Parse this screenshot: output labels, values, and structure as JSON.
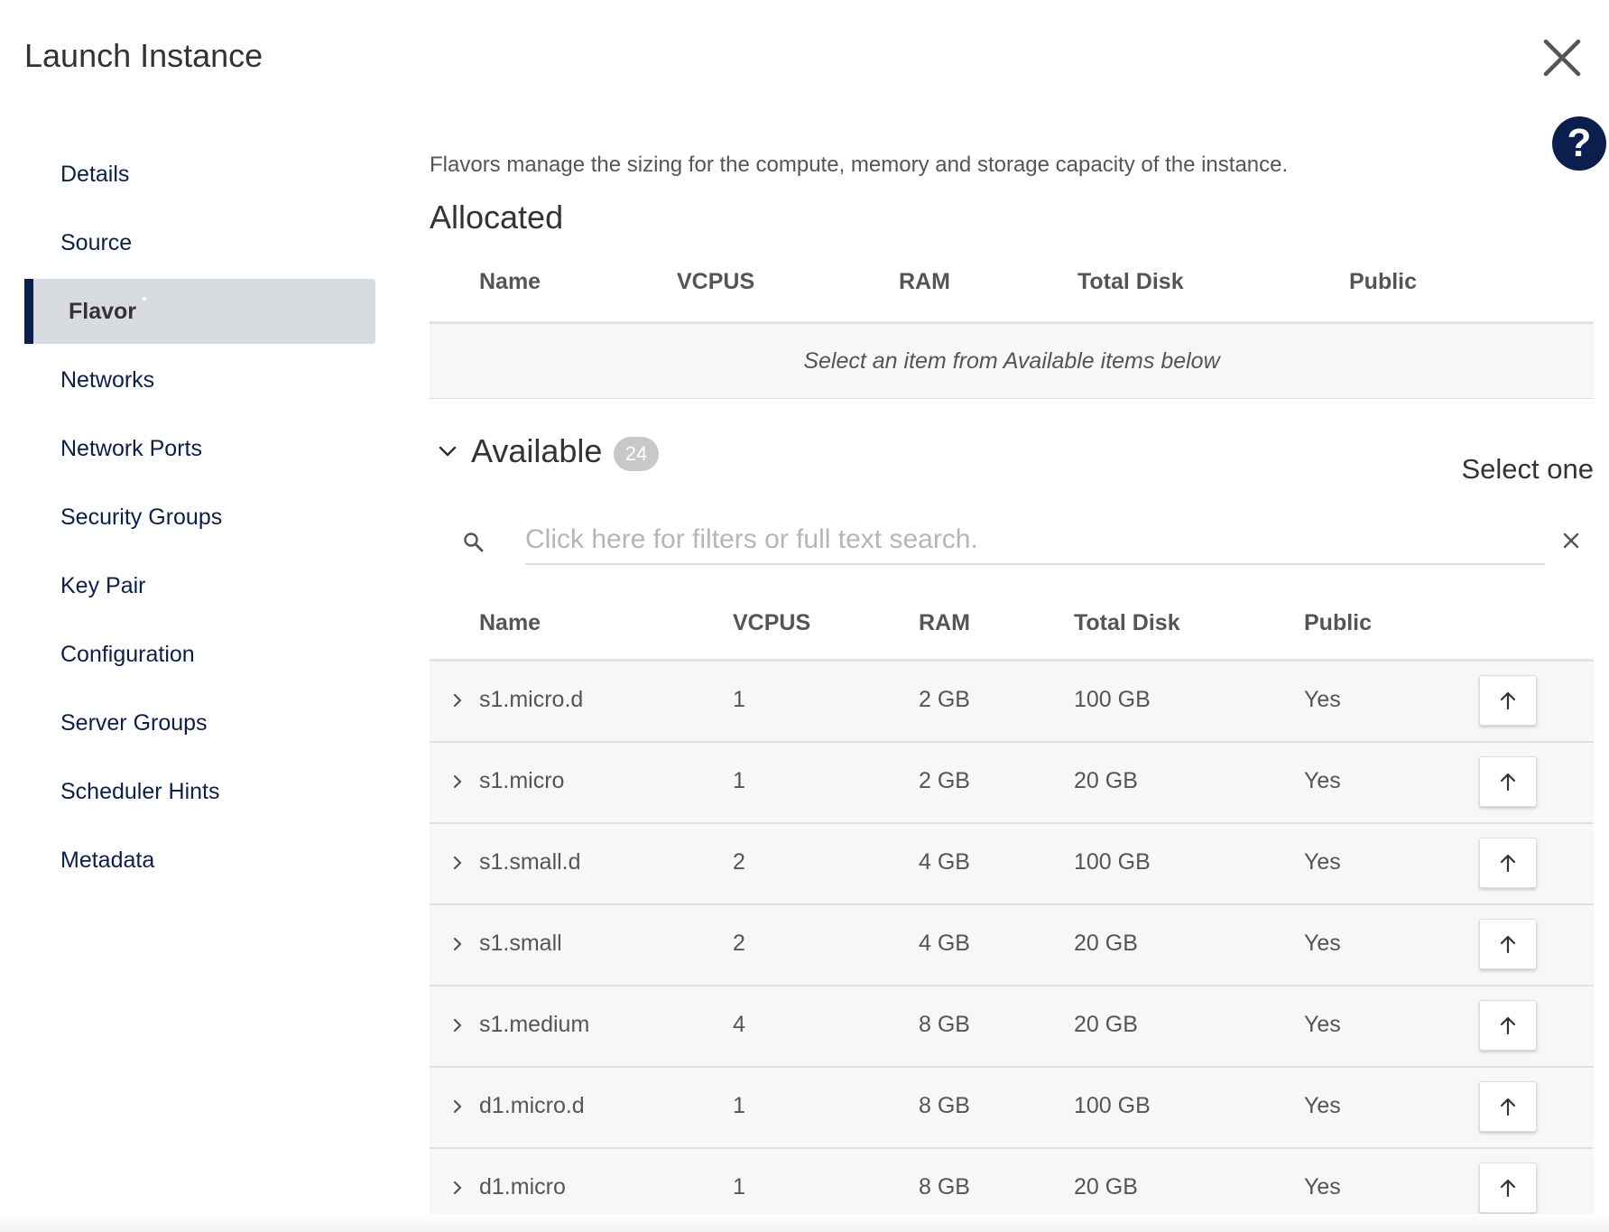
{
  "modal": {
    "title": "Launch Instance"
  },
  "icons": {
    "close": "close-icon",
    "help": "help-icon",
    "search": "search-icon",
    "clear": "clear-icon",
    "expand": "chevron-right-icon",
    "collapse": "chevron-down-icon",
    "allocate": "arrow-up-icon"
  },
  "colors": {
    "accent": "#0b1f4f",
    "active_bg": "#d8dbe0",
    "badge_bg": "#c8c8c8",
    "row_bg": "#f7f7f7"
  },
  "help": {
    "label": "?"
  },
  "sidebar": {
    "items": [
      {
        "label": "Details"
      },
      {
        "label": "Source"
      },
      {
        "label": "Flavor",
        "active": true,
        "required": "*"
      },
      {
        "label": "Networks"
      },
      {
        "label": "Network Ports"
      },
      {
        "label": "Security Groups"
      },
      {
        "label": "Key Pair"
      },
      {
        "label": "Configuration"
      },
      {
        "label": "Server Groups"
      },
      {
        "label": "Scheduler Hints"
      },
      {
        "label": "Metadata"
      }
    ]
  },
  "main": {
    "description": "Flavors manage the sizing for the compute, memory and storage capacity of the instance.",
    "allocated": {
      "title": "Allocated",
      "columns": [
        "Name",
        "VCPUS",
        "RAM",
        "Total Disk",
        "Public"
      ],
      "empty_message": "Select an item from Available items below"
    },
    "available": {
      "title": "Available",
      "count": "24",
      "select_hint": "Select one",
      "search_placeholder": "Click here for filters or full text search.",
      "search_value": "",
      "columns": [
        "Name",
        "VCPUS",
        "RAM",
        "Total Disk",
        "Public"
      ],
      "rows": [
        {
          "name": "s1.micro.d",
          "vcpus": "1",
          "ram": "2 GB",
          "disk": "100 GB",
          "public": "Yes"
        },
        {
          "name": "s1.micro",
          "vcpus": "1",
          "ram": "2 GB",
          "disk": "20 GB",
          "public": "Yes"
        },
        {
          "name": "s1.small.d",
          "vcpus": "2",
          "ram": "4 GB",
          "disk": "100 GB",
          "public": "Yes"
        },
        {
          "name": "s1.small",
          "vcpus": "2",
          "ram": "4 GB",
          "disk": "20 GB",
          "public": "Yes"
        },
        {
          "name": "s1.medium",
          "vcpus": "4",
          "ram": "8 GB",
          "disk": "20 GB",
          "public": "Yes"
        },
        {
          "name": "d1.micro.d",
          "vcpus": "1",
          "ram": "8 GB",
          "disk": "100 GB",
          "public": "Yes"
        },
        {
          "name": "d1.micro",
          "vcpus": "1",
          "ram": "8 GB",
          "disk": "20 GB",
          "public": "Yes"
        }
      ]
    }
  }
}
